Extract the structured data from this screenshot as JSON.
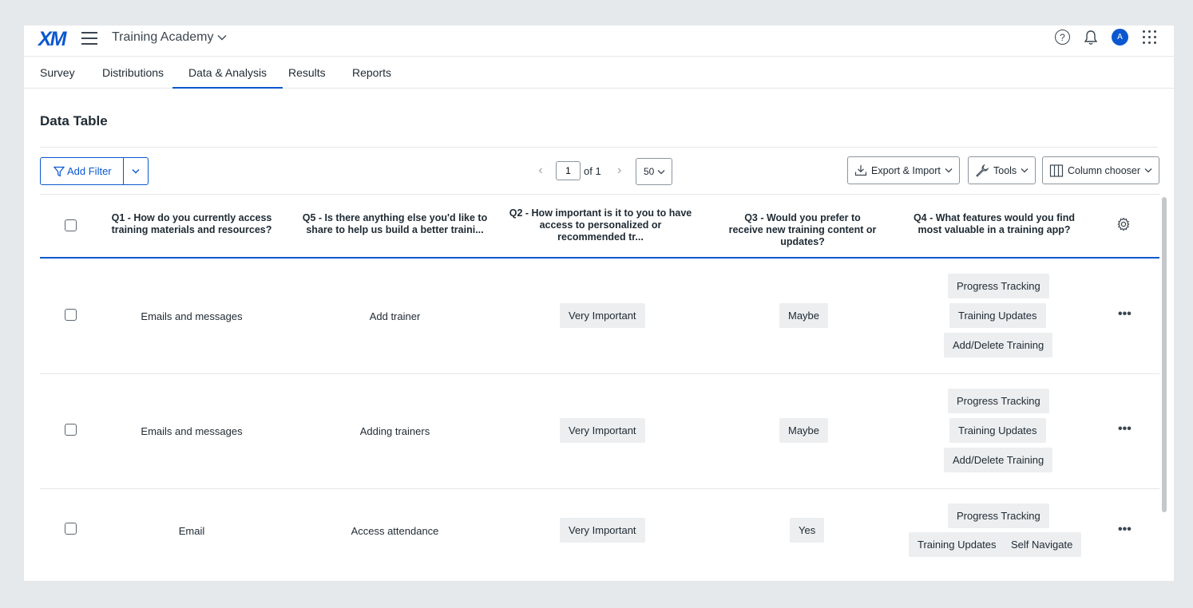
{
  "app": {
    "logo": "XM",
    "project_title": "Training Academy",
    "avatar_initial": "A"
  },
  "tabs": [
    "Survey",
    "Distributions",
    "Data & Analysis",
    "Results",
    "Reports"
  ],
  "page": {
    "title": "Data Table"
  },
  "toolbar": {
    "add_filter": "Add Filter",
    "page_current": "1",
    "page_of": "of 1",
    "per_page": "50",
    "export_import": "Export & Import",
    "tools": "Tools",
    "column_chooser": "Column chooser"
  },
  "table": {
    "headers": [
      "Q1 - How do you currently access training materials and resources?",
      "Q5 - Is there anything else you'd like to share to help us build a better traini...",
      "Q2 - How important is it to you to have access to personalized or recommended tr...",
      "Q3 - Would you prefer to receive new training content or updates?",
      "Q4 - What features would you find most valuable in a training app?"
    ],
    "rows": [
      {
        "q1": "Emails and messages",
        "q5": "Add trainer",
        "q2": "Very Important",
        "q3": "Maybe",
        "q4": [
          "Progress Tracking",
          "Training Updates",
          "Add/Delete Training"
        ]
      },
      {
        "q1": "Emails and messages",
        "q5": "Adding trainers",
        "q2": "Very Important",
        "q3": "Maybe",
        "q4": [
          "Progress Tracking",
          "Training Updates",
          "Add/Delete Training"
        ]
      },
      {
        "q1": "Email",
        "q5": "Access attendance",
        "q2": "Very Important",
        "q3": "Yes",
        "q4": [
          "Progress Tracking",
          "Training Updates",
          "Self Navigate"
        ]
      }
    ]
  },
  "icons": {
    "menu": "hamburger-icon",
    "help": "help-icon",
    "bell": "bell-icon",
    "apps": "apps-grid-icon",
    "settings": "gear-icon",
    "row_actions": "more-icon"
  },
  "colors": {
    "accent": "#0b57d0",
    "tag_bg": "#eceef0",
    "page_bg": "#e6e9ec"
  }
}
